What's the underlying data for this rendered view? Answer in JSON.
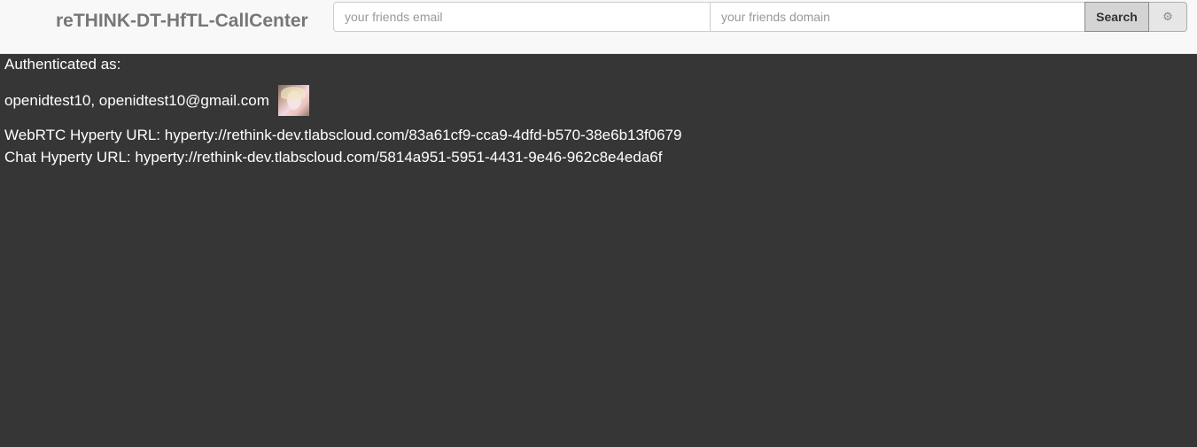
{
  "navbar": {
    "brand": "reTHINK-DT-HfTL-CallCenter",
    "email_placeholder": "your friends email",
    "domain_placeholder": "your friends domain",
    "search_label": "Search",
    "settings_icon": "gear-icon",
    "settings_glyph": "⚙"
  },
  "main": {
    "auth_label": "Authenticated as:",
    "user_text": "openidtest10, openidtest10@gmail.com",
    "webrtc_label": "WebRTC Hyperty URL: hyperty://rethink-dev.tlabscloud.com/83a61cf9-cca9-4dfd-b570-38e6b13f0679",
    "chat_label": "Chat Hyperty URL: hyperty://rethink-dev.tlabscloud.com/5814a951-5951-4431-9e46-962c8e4eda6f"
  },
  "colors": {
    "navbar_bg": "#f8f8f8",
    "content_bg": "#363636",
    "text": "#ffffff",
    "brand": "#777777"
  }
}
